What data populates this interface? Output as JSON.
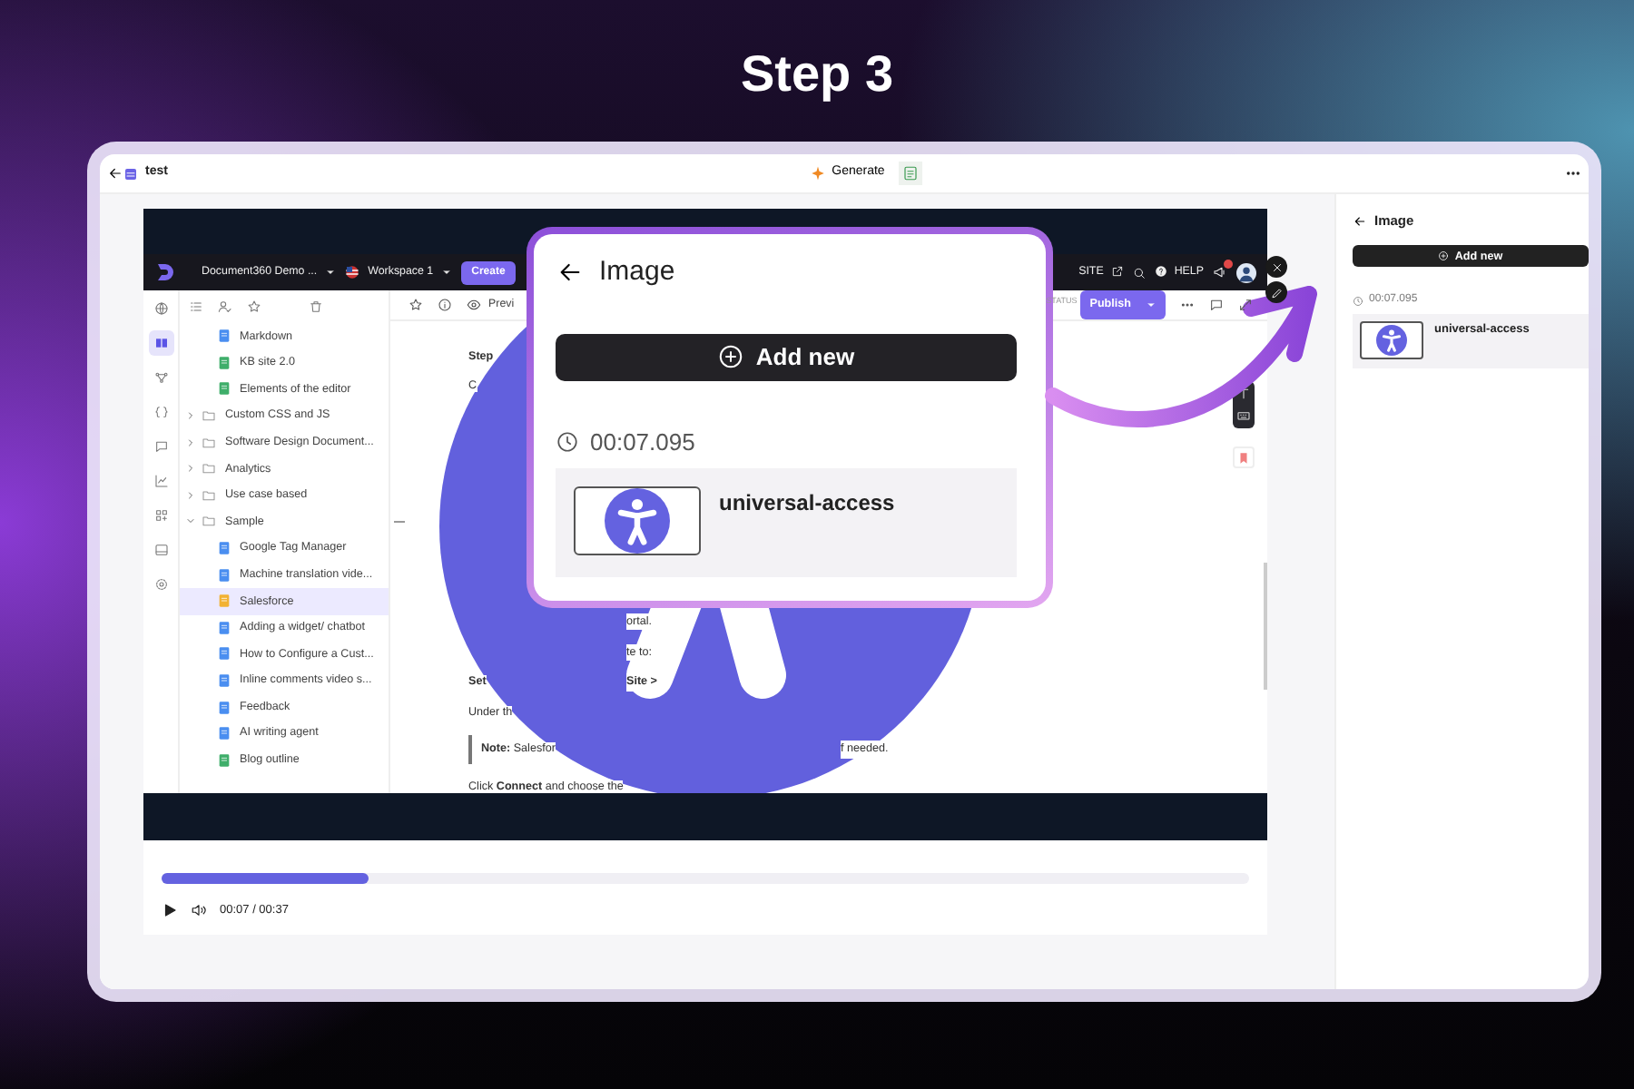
{
  "heading": "Step 3",
  "topbar": {
    "title": "test",
    "generate": "Generate"
  },
  "app": {
    "project": "Document360 Demo ...",
    "workspace": "Workspace 1",
    "create": "Create",
    "site": "SITE",
    "help": "HELP",
    "rail": [
      {
        "selected": false
      },
      {
        "selected": true
      },
      {
        "selected": false
      },
      {
        "selected": false
      },
      {
        "selected": false
      },
      {
        "selected": false
      },
      {
        "selected": false
      },
      {
        "selected": false
      },
      {
        "selected": false
      }
    ],
    "tree": [
      {
        "kind": "article",
        "label": "Markdown",
        "color": "#4a8ef0",
        "selected": false
      },
      {
        "kind": "article",
        "label": "KB site 2.0",
        "color": "#3fae6a",
        "selected": false
      },
      {
        "kind": "article",
        "label": "Elements of the editor",
        "color": "#3fae6a",
        "selected": false
      },
      {
        "kind": "folder",
        "label": "Custom CSS and JS",
        "expanded": false,
        "selected": false
      },
      {
        "kind": "folder",
        "label": "Software Design Document...",
        "expanded": false,
        "selected": false
      },
      {
        "kind": "folder",
        "label": "Analytics",
        "expanded": false,
        "selected": false
      },
      {
        "kind": "folder",
        "label": "Use case based",
        "expanded": false,
        "selected": false
      },
      {
        "kind": "folder",
        "label": "Sample",
        "expanded": true,
        "selected": false,
        "children": [
          {
            "kind": "article",
            "label": "Google Tag Manager",
            "color": "#4a8ef0",
            "selected": false
          },
          {
            "kind": "article",
            "label": "Machine translation vide...",
            "color": "#4a8ef0",
            "selected": false
          },
          {
            "kind": "article",
            "label": "Salesforce",
            "color": "#f2b233",
            "selected": true
          },
          {
            "kind": "article",
            "label": "Adding a widget/ chatbot",
            "color": "#4a8ef0",
            "selected": false
          },
          {
            "kind": "article",
            "label": "How to Configure a Cust...",
            "color": "#4a8ef0",
            "selected": false
          },
          {
            "kind": "article",
            "label": "Inline comments video s...",
            "color": "#4a8ef0",
            "selected": false
          },
          {
            "kind": "article",
            "label": "Feedback",
            "color": "#4a8ef0",
            "selected": false
          },
          {
            "kind": "article",
            "label": "AI writing agent",
            "color": "#4a8ef0",
            "selected": false
          },
          {
            "kind": "article",
            "label": "Blog outline",
            "color": "#3fae6a",
            "selected": false
          }
        ]
      }
    ],
    "editor_toolbar": {
      "preview": "Previ",
      "status": "STATUS",
      "publish": "Publish"
    },
    "intro": [
      {
        "kind": "heading",
        "left": "Step"
      },
      {
        "kind": "text",
        "left": "C"
      }
    ],
    "body": [
      {
        "kind": "text",
        "right": "ortal."
      },
      {
        "kind": "text",
        "right": "te to:"
      },
      {
        "kind": "heading",
        "left": "Set",
        "right": "Site >"
      },
      {
        "kind": "text",
        "left": "Under th"
      },
      {
        "kind": "note",
        "left": "**Note:** Salesfor",
        "right": "f needed."
      },
      {
        "kind": "text",
        "left": "Click **Connect** and choose the"
      }
    ]
  },
  "overlay_card": {
    "title": "Image",
    "add_new": "Add new",
    "timestamp": "00:07.095",
    "items": [
      {
        "label": "universal-access"
      }
    ]
  },
  "player": {
    "level": 0.19,
    "time": "00:07 / 00:37"
  },
  "panel": {
    "title": "Image",
    "add_new": "Add new",
    "timestamp": "00:07.095",
    "items": [
      {
        "label": "universal-access"
      }
    ]
  }
}
